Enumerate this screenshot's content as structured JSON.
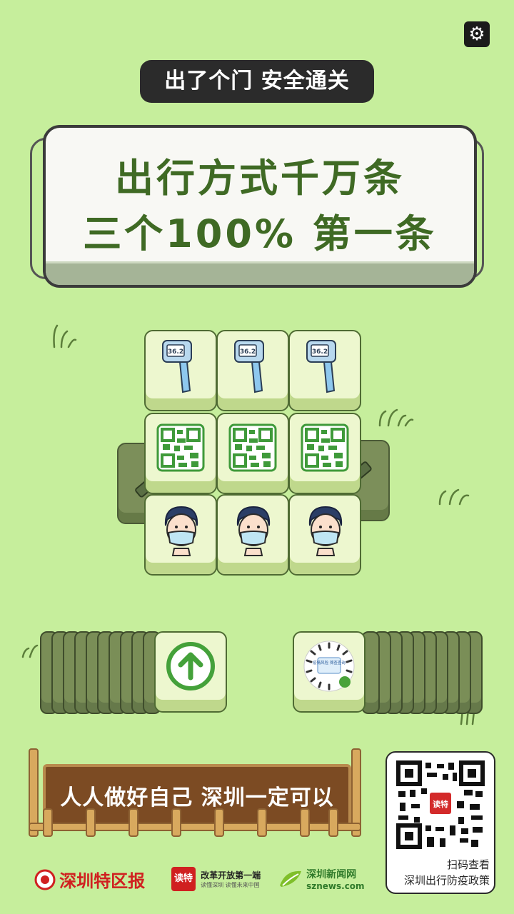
{
  "header": {
    "settings_icon": "gear-icon",
    "title_pill": "出了个门  安全通关"
  },
  "banner": {
    "line1": "出行方式千万条",
    "line2": "三个100% 第一条"
  },
  "board": {
    "rows": [
      {
        "tile": "thermometer",
        "label": "36.2",
        "count": 3
      },
      {
        "tile": "health-code",
        "count": 3
      },
      {
        "tile": "masked-person",
        "count": 3
      }
    ],
    "side_tiles": [
      "vaccine-syringe",
      "vaccine-syringe"
    ]
  },
  "slots": {
    "left_current_tile": "up-arrow",
    "right_current_tile": "mini-program-code",
    "mini_code_text": "疫情风险 筛查查询"
  },
  "footer": {
    "slogan": "人人做好自己 深圳一定可以",
    "qr_caption_1": "扫码查看",
    "qr_caption_2": "深圳出行防疫政策",
    "qr_badge": "读特",
    "logo_1": "深圳特区报",
    "logo_2_badge": "读特",
    "logo_2_title": "改革开放第一端",
    "logo_2_sub": "读懂深圳  读懂未来中国",
    "logo_3_title": "深圳新闻网",
    "logo_3_sub": "sznews.com"
  },
  "colors": {
    "background": "#c6ee9c",
    "banner_text": "#3f6a24",
    "pill": "#2b2b2b",
    "fence": "#7c4b23"
  }
}
